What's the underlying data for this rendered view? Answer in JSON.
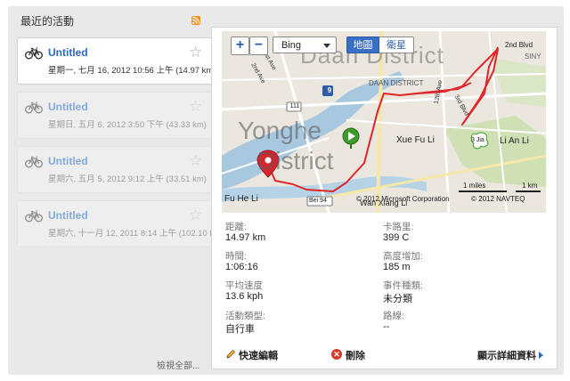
{
  "sidebar": {
    "title": "最近的活動",
    "view_all": "檢視全部...",
    "activities": [
      {
        "title": "Untitled",
        "subtitle": "星期一, 七月 16, 2012 10:56 上午 (14.97 km)"
      },
      {
        "title": "Untitled",
        "subtitle": "星期日, 五月 6, 2012 3:50 下午 (43.33 km)"
      },
      {
        "title": "Untitled",
        "subtitle": "星期六, 五月 5, 2012 9:12 上午 (33.51 km)"
      },
      {
        "title": "Untitled",
        "subtitle": "星期六, 十一月 12, 2011 8:14 上午 (102.10 km)"
      }
    ]
  },
  "map": {
    "zoom_in": "+",
    "zoom_out": "−",
    "provider": "Bing",
    "type_map": "地圖",
    "type_satellite": "衛星",
    "copyright": "© 2012 Microsoft Corporation",
    "copyright2": "© 2012 NAVTEQ",
    "scale_miles": "1 miles",
    "scale_km": "1 km",
    "labels": {
      "daan_district": "Daan District",
      "daan_zh": "DAAN DISTRICT",
      "yonghe": "Yonghe",
      "district": "District",
      "xue_fu_li": "Xue Fu Li",
      "li_an_li": "Li An Li",
      "fu_he_li": "Fu He Li",
      "wan_xiang_li": "Wan Xiang Li",
      "second_blvd": "2nd Blvd",
      "first_st_ave": "1st Ave",
      "second_ave": "2nd Ave",
      "twelfth_ave": "12th Ave",
      "third_blvd": "3rd Blvd",
      "sin": "SINY",
      "bei94": "Bei 94",
      "shield_9": "9",
      "road_111": "111",
      "road_3jia": "3 Jia"
    }
  },
  "stats": {
    "distance_label": "距離:",
    "distance_value": "14.97 km",
    "calories_label": "卡路里:",
    "calories_value": "399 C",
    "time_label": "時間:",
    "time_value": "1:06:16",
    "elev_label": "高度增加:",
    "elev_value": "185 m",
    "speed_label": "平均速度",
    "speed_value": "13.6 kph",
    "event_label": "事件種類:",
    "event_value": "未分類",
    "activity_label": "活動類型:",
    "activity_value": "自行車",
    "route_label": "路線:",
    "route_value": "--"
  },
  "actions": {
    "quick_edit": "快速編輯",
    "delete": "刪除",
    "details": "顯示詳細資料"
  },
  "colors": {
    "accent": "#2a6bbf",
    "track": "#e0262b",
    "rss": "#f5901e"
  }
}
